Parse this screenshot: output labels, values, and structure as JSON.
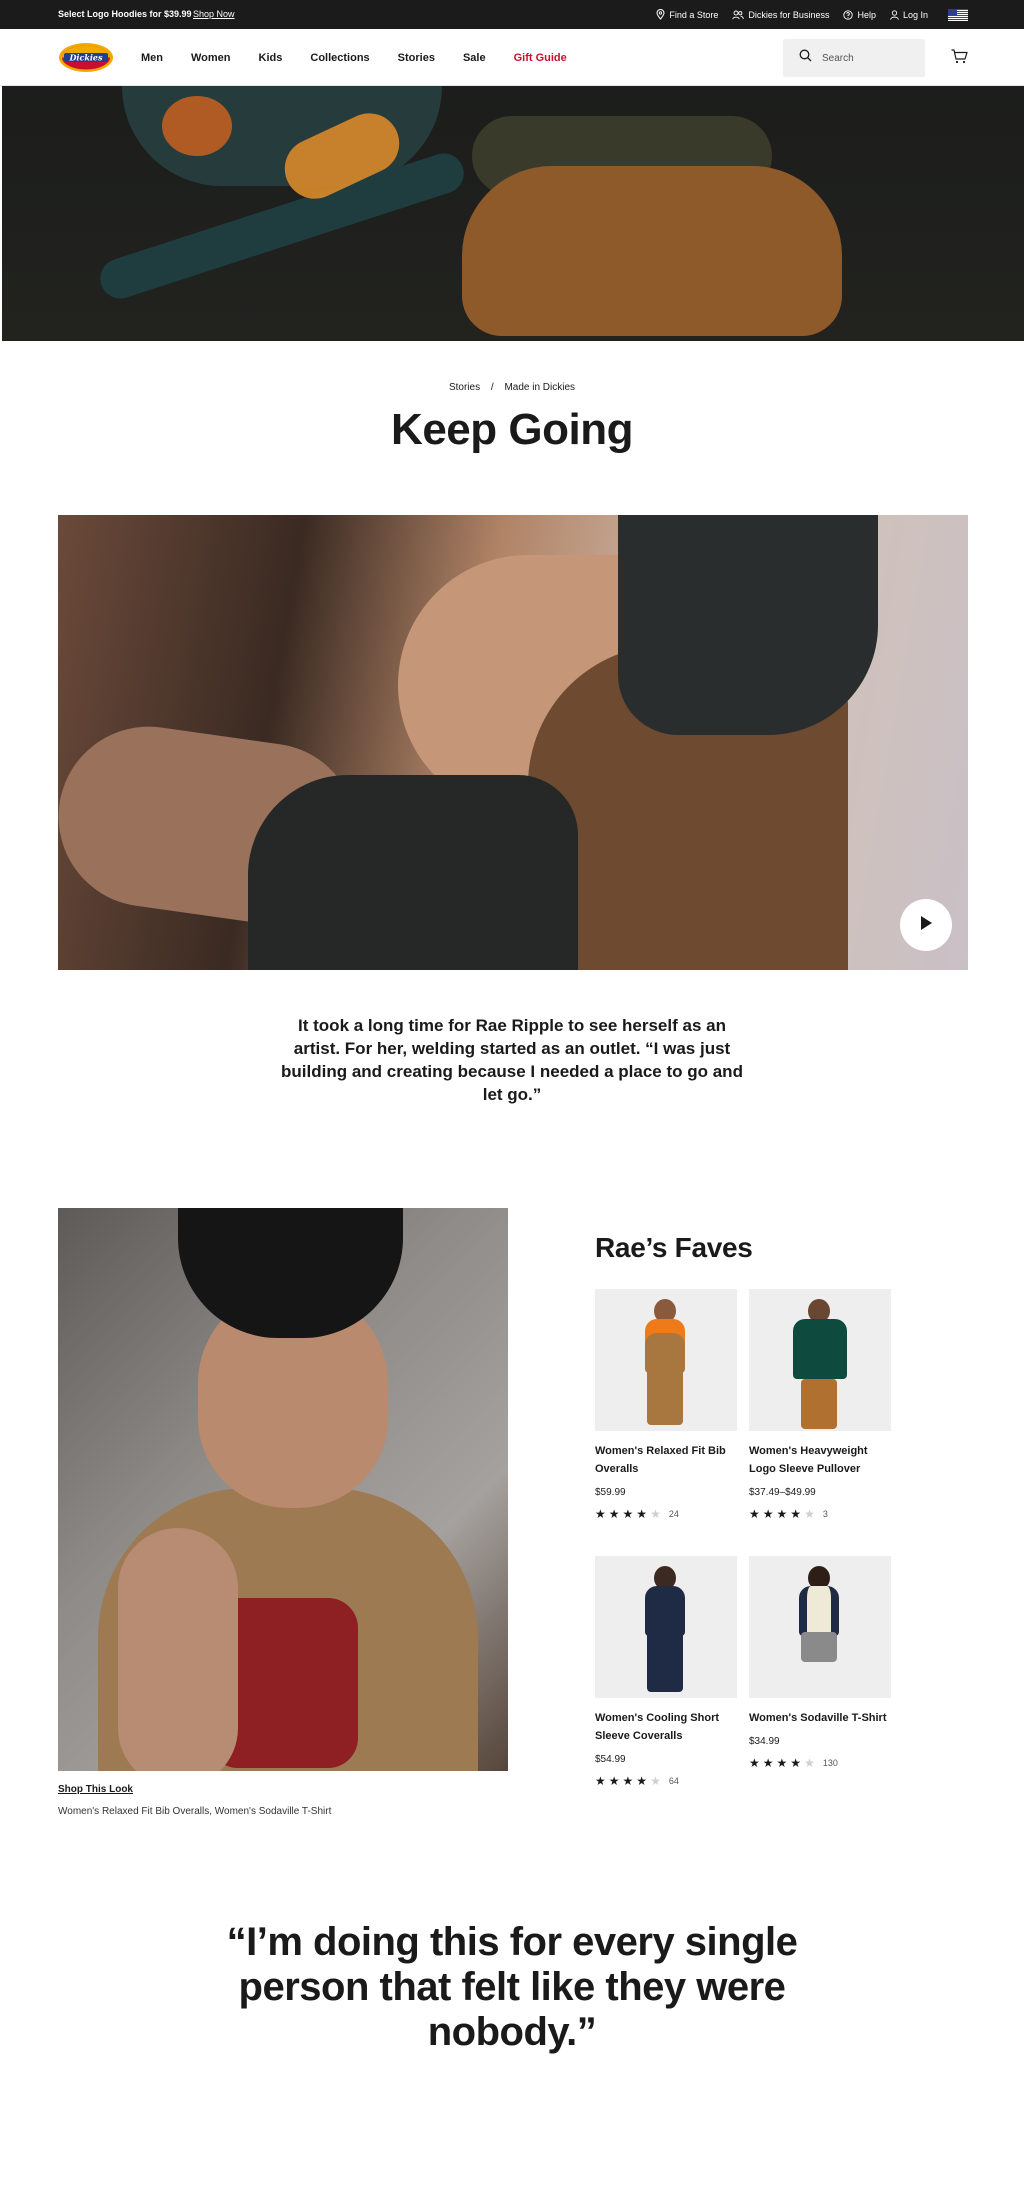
{
  "topbar": {
    "promo": "Select Logo Hoodies for $39.99",
    "shop_now": "Shop Now",
    "links": {
      "find_store": "Find a Store",
      "business": "Dickies for Business",
      "help": "Help",
      "login": "Log In"
    }
  },
  "nav": {
    "logo_text": "Dickies",
    "items": [
      "Men",
      "Women",
      "Kids",
      "Collections",
      "Stories",
      "Sale",
      "Gift Guide"
    ],
    "search_placeholder": "Search"
  },
  "breadcrumb": {
    "parent": "Stories",
    "separator": "/",
    "current": "Made in Dickies"
  },
  "page_title": "Keep Going",
  "intro": "It took a long time for Rae Ripple to see herself as an artist. For her, welding started as an outlet. “I was just building and creating because I needed a place to go and let go.”",
  "shop_look": {
    "title": "Shop This Look",
    "items": "Women's Relaxed Fit Bib Overalls, Women's Sodaville T-Shirt"
  },
  "faves": {
    "title": "Rae’s Faves",
    "products": [
      {
        "name": "Women's Relaxed Fit Bib Overalls",
        "price": "$59.99",
        "rating": 4,
        "reviews": "24"
      },
      {
        "name": "Women's Heavyweight Logo Sleeve Pullover",
        "price": "$37.49–$49.99",
        "rating": 4,
        "reviews": "3"
      },
      {
        "name": "Women's Cooling Short Sleeve Coveralls",
        "price": "$54.99",
        "rating": 4,
        "reviews": "64"
      },
      {
        "name": "Women's Sodaville T-Shirt",
        "price": "$34.99",
        "rating": 4,
        "reviews": "130"
      }
    ]
  },
  "quote": "“I’m doing this for every single person that felt like they were nobody.”",
  "colors": {
    "topbar_bg": "#1b1b1b",
    "accent_red": "#c8102e",
    "text": "#1a1a1a",
    "search_bg": "#f0f0f0"
  },
  "icons": [
    "location-pin-icon",
    "people-icon",
    "help-circle-icon",
    "user-icon",
    "us-flag-icon",
    "search-icon",
    "cart-icon",
    "play-icon",
    "star-icon"
  ]
}
